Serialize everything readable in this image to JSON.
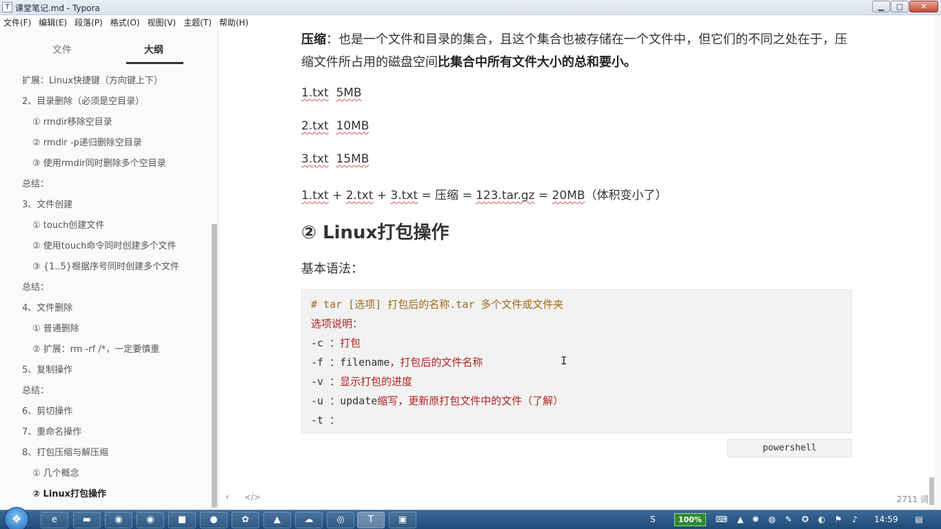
{
  "window": {
    "app_icon": "T",
    "title": "课堂笔记.md - Typora",
    "btn_min": "▁",
    "btn_max": "▢",
    "btn_close": "✕"
  },
  "menu": [
    "文件(F)",
    "编辑(E)",
    "段落(P)",
    "格式(O)",
    "视图(V)",
    "主题(T)",
    "帮助(H)"
  ],
  "sidebar": {
    "tab_files": "文件",
    "tab_outline": "大纲",
    "items": [
      {
        "text": "扩展：Linux快捷键（方向键上下）",
        "level": 1
      },
      {
        "text": "2、目录删除（必须是空目录）",
        "level": 1
      },
      {
        "text": "① rmdir移除空目录",
        "level": 2
      },
      {
        "text": "② rmdir -p递归删除空目录",
        "level": 2
      },
      {
        "text": "③ 使用rmdir同时删除多个空目录",
        "level": 2
      },
      {
        "text": "总结：",
        "level": 1
      },
      {
        "text": "3、文件创建",
        "level": 1
      },
      {
        "text": "① touch创建文件",
        "level": 2
      },
      {
        "text": "② 使用touch命令同时创建多个文件",
        "level": 2
      },
      {
        "text": "③ {1..5}根据序号同时创建多个文件",
        "level": 2
      },
      {
        "text": "总结：",
        "level": 1
      },
      {
        "text": "4、文件删除",
        "level": 1
      },
      {
        "text": "① 普通删除",
        "level": 2
      },
      {
        "text": "② 扩展：rm -rf /*，一定要慎重",
        "level": 2
      },
      {
        "text": "5、复制操作",
        "level": 1
      },
      {
        "text": "总结：",
        "level": 1
      },
      {
        "text": "6、剪切操作",
        "level": 1
      },
      {
        "text": "7、重命名操作",
        "level": 1
      },
      {
        "text": "8、打包压缩与解压缩",
        "level": 1
      },
      {
        "text": "① 几个概念",
        "level": 2
      },
      {
        "text": "② Linux打包操作",
        "level": 2,
        "active": true
      }
    ]
  },
  "editor": {
    "p1_bold": "压缩",
    "p1_text": "：也是一个文件和目录的集合，且这个集合也被存储在一个文件中，但它们的不同之处在于，压缩文件所占用的磁盘空间",
    "p1_bold_end": "比集合中所有文件大小的总和要小。",
    "l1_file": "1.txt",
    "l1_size": "5MB",
    "l2_file": "2.txt",
    "l2_size": "10MB",
    "l3_file": "3.txt",
    "l3_size": "15MB",
    "l4_a": "1.txt",
    "l4_plus1": " + ",
    "l4_b": "2.txt",
    "l4_plus2": " + ",
    "l4_c": "3.txt",
    "l4_mid": " = 压缩 = ",
    "l4_archive": "123.tar.gz",
    "l4_eq": " = ",
    "l4_total": "20MB",
    "l4_tail": "（体积变小了）",
    "heading": "② Linux打包操作",
    "syntax": "基本语法：",
    "code": {
      "line1": "# tar [选项]  打包后的名称.tar  多个文件或文件夹",
      "line2": "选项说明：",
      "line3_opt": "-c ：",
      "line3_desc": "打包",
      "line4_opt": "-f ：",
      "line4_mid": "filename",
      "line4_desc": "，打包后的文件名称",
      "line5_opt": "-v ：",
      "line5_desc": "显示打包的进度",
      "line6_opt": "-u ：",
      "line6_mid": "update",
      "line6_desc": "缩写，更新原打包文件中的文件（了解）",
      "line7_opt": "-t ："
    },
    "code_lang": "powershell",
    "footer_back": "‹",
    "footer_source": "</>",
    "word_count": "2711 词"
  },
  "taskbar": {
    "start_icon": "❖",
    "apps": [
      "ie-icon",
      "folder-icon",
      "chrome-icon",
      "chrome-icon",
      "app-icon",
      "firefox-icon",
      "remote-icon",
      "vm-icon",
      "cloud-icon",
      "netease-icon",
      "typora-icon",
      "window-icon"
    ],
    "battery": "100%",
    "clock": "14:59"
  },
  "colors": {
    "code_comment": "#a0681a",
    "code_red": "#b22222",
    "taskbar": "#1f4b78"
  }
}
